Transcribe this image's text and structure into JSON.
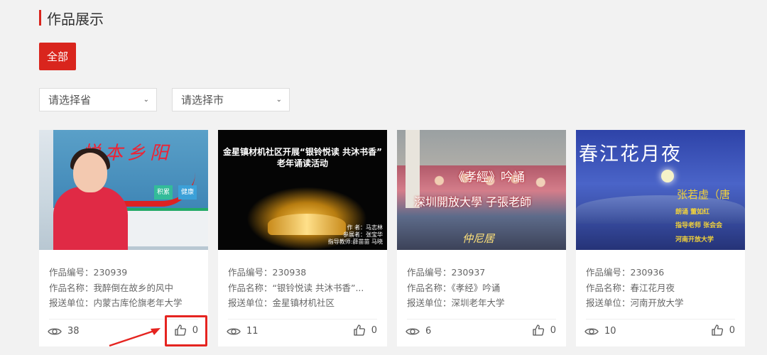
{
  "section": {
    "title": "作品展示"
  },
  "filters": {
    "all_label": "全部",
    "province_placeholder": "请选择省",
    "city_placeholder": "请选择市"
  },
  "labels": {
    "id": "作品编号：",
    "name": "作品名称：",
    "unit": "报送单位："
  },
  "cards": [
    {
      "id": "230939",
      "name": "我醉倒在故乡的风中",
      "unit": "内蒙古库伦旗老年大学",
      "views": "38",
      "likes": "0",
      "thumb": {
        "banner": "悦本乡阳",
        "sign1": "积累",
        "sign2": "健康"
      }
    },
    {
      "id": "230938",
      "name": "“银铃悦读 共沐书香”...",
      "unit": "金星镇材机社区",
      "views": "11",
      "likes": "0",
      "thumb": {
        "line1": "金星镇材机社区开展“银铃悦读 共沐书香”",
        "line2": "老年诵读活动",
        "credit1": "作  者：马志林",
        "credit2": "参展者：张宝华",
        "credit3": "指导教师:薛苗苗 马晓"
      }
    },
    {
      "id": "230937",
      "name": "《孝经》吟诵",
      "unit": "深圳老年大学",
      "views": "6",
      "likes": "0",
      "thumb": {
        "cap1": "《孝經》吟誦",
        "cap2": "深圳開放大學 子張老師",
        "cap3": "仲尼居"
      }
    },
    {
      "id": "230936",
      "name": "春江花月夜",
      "unit": "河南开放大学",
      "views": "10",
      "likes": "0",
      "thumb": {
        "title": "春江花月夜",
        "author": "张若虚（唐",
        "line1": "朗诵        董如红",
        "line2": "指导老师    张会会",
        "line3": "河南开放大学"
      }
    }
  ],
  "colors": {
    "accent": "#d9251d",
    "annotation": "#e52420"
  }
}
